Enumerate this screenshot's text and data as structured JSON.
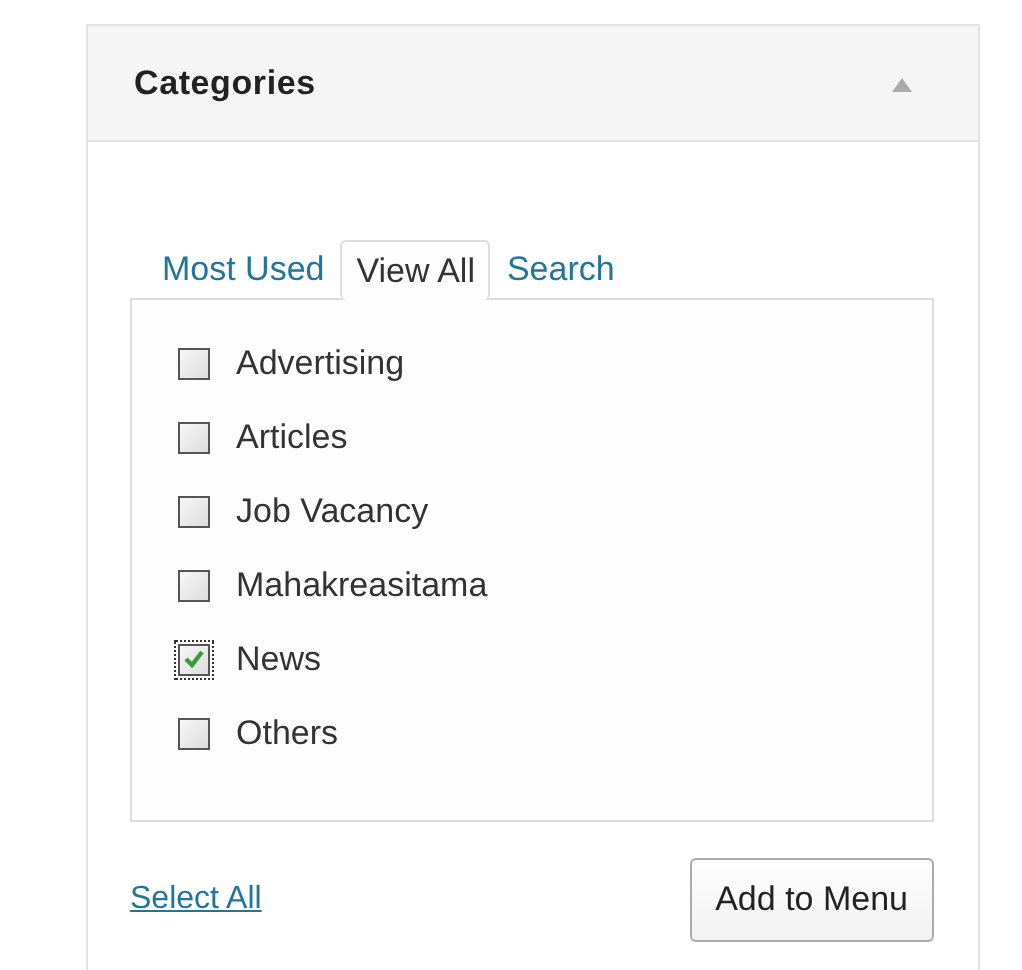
{
  "panel": {
    "title": "Categories",
    "expanded": true
  },
  "tabs": [
    {
      "label": "Most Used",
      "selected": false
    },
    {
      "label": "View All",
      "selected": true
    },
    {
      "label": "Search",
      "selected": false
    }
  ],
  "categories": [
    {
      "label": "Advertising",
      "checked": false
    },
    {
      "label": "Articles",
      "checked": false
    },
    {
      "label": "Job Vacancy",
      "checked": false
    },
    {
      "label": "Mahakreasitama",
      "checked": false
    },
    {
      "label": "News",
      "checked": true
    },
    {
      "label": "Others",
      "checked": false
    }
  ],
  "select_all": "Select All",
  "add_button": "Add to Menu"
}
